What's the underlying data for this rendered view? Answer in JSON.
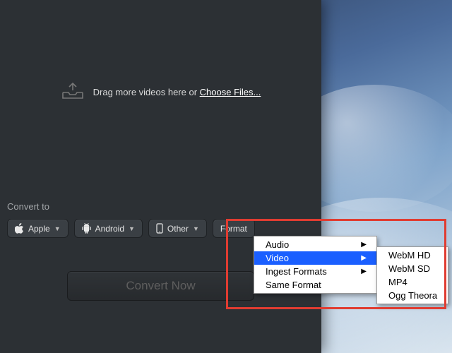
{
  "drop": {
    "text_prefix": "Drag more videos here or ",
    "link_label": "Choose Files..."
  },
  "convert": {
    "label": "Convert to",
    "buttons": {
      "apple": "Apple",
      "android": "Android",
      "other": "Other",
      "format": "Format"
    },
    "convert_now_label": "Convert Now"
  },
  "menu": {
    "main": {
      "audio": "Audio",
      "video": "Video",
      "ingest": "Ingest Formats",
      "same": "Same Format"
    },
    "video_sub": {
      "webm_hd": "WebM HD",
      "webm_sd": "WebM SD",
      "mp4": "MP4",
      "ogg": "Ogg Theora"
    }
  }
}
